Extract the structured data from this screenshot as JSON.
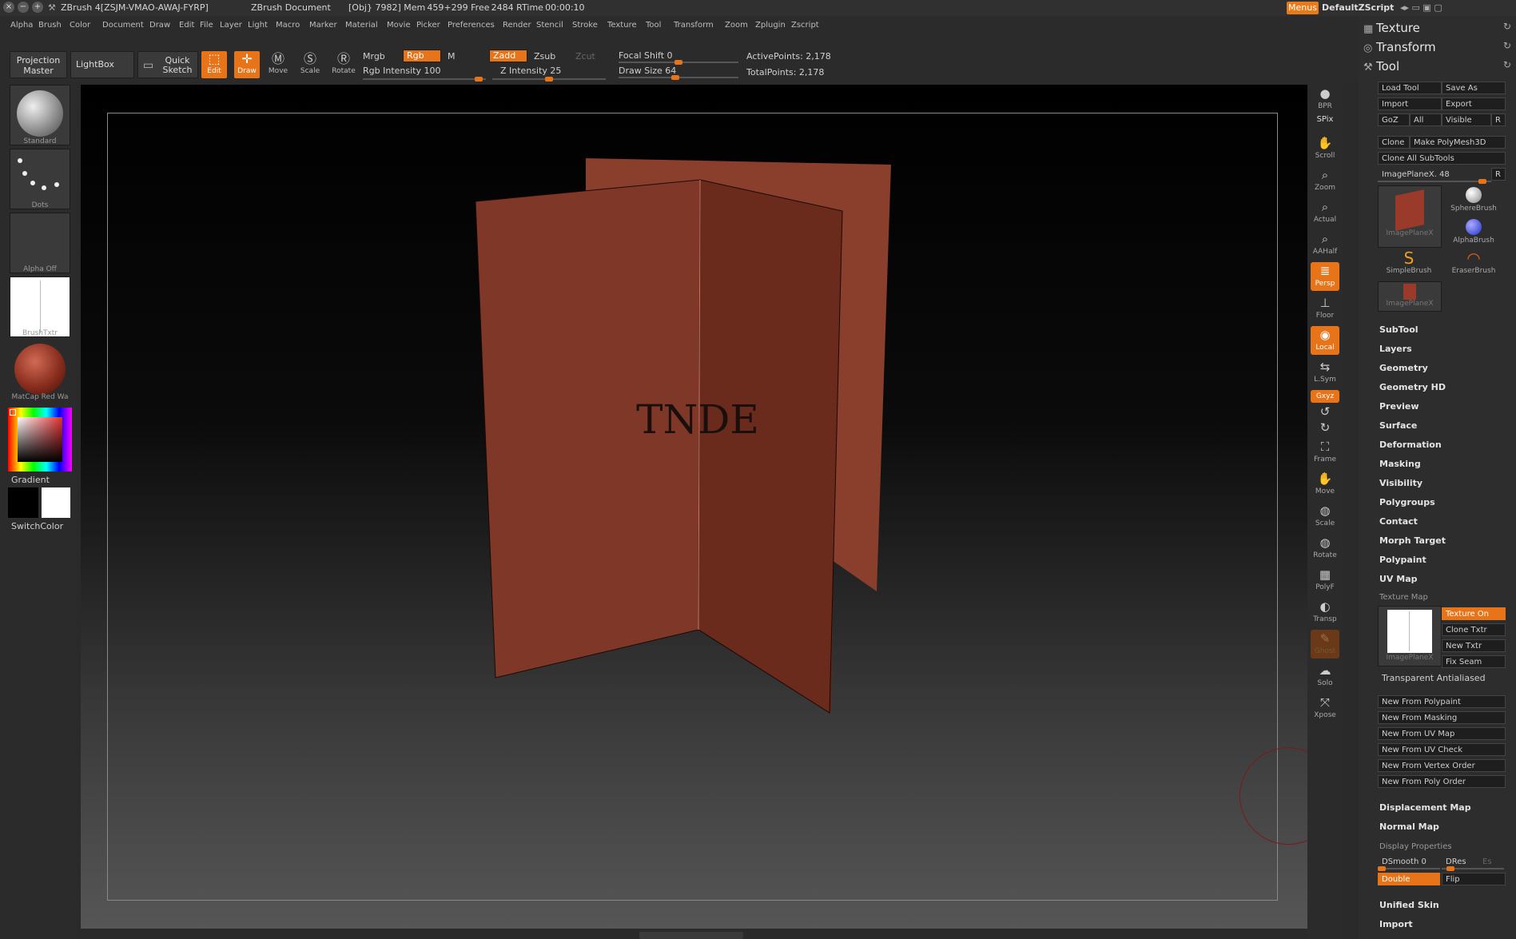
{
  "titlebar": {
    "app_title": "ZBrush 4[ZSJM-VMAO-AWAJ-FYRP]",
    "document": "ZBrush Document",
    "status": "[Obj} 7982] Mem 459+299 Free 2484 RTime 00:00:10",
    "menus_label": "Menus",
    "script_label": "DefaultZScript"
  },
  "menubar": [
    "Alpha",
    "Brush",
    "Color",
    "Document",
    "Draw",
    "Edit",
    "File",
    "Layer",
    "Light",
    "Macro",
    "Marker",
    "Material",
    "Movie",
    "Picker",
    "Preferences",
    "Render",
    "Stencil",
    "Stroke",
    "Texture",
    "Tool",
    "Transform",
    "Zoom",
    "Zplugin",
    "Zscript"
  ],
  "toolbar": {
    "projection_master": "Projection Master",
    "lightbox": "LightBox",
    "quick_sketch": "Quick Sketch",
    "edit": "Edit",
    "draw": "Draw",
    "move": "Move",
    "scale": "Scale",
    "rotate": "Rotate",
    "mrgb": "Mrgb",
    "rgb": "Rgb",
    "m": "M",
    "rgb_intensity_label": "Rgb  Intensity 100",
    "rgb_intensity": 100,
    "zadd": "Zadd",
    "zsub": "Zsub",
    "zcut": "Zcut",
    "z_intensity_label": "Z  Intensity 25",
    "z_intensity": 25,
    "focal_shift_label": "Focal  Shift 0",
    "focal_shift": 0,
    "draw_size_label": "Draw  Size 64",
    "draw_size": 64,
    "active_points": "ActivePoints: 2,178",
    "total_points": "TotalPoints: 2,178"
  },
  "leftshelf": {
    "brush": "Standard",
    "stroke": "Dots",
    "alpha": "Alpha  Off",
    "texture": "BrushTxtr",
    "material": "MatCap  Red  Wa",
    "gradient": "Gradient",
    "switch_color": "SwitchColor"
  },
  "viewport": {
    "model_text": "TNDE"
  },
  "rightshelf": [
    "BPR",
    "SPix",
    "Scroll",
    "Zoom",
    "Actual",
    "AAHalf",
    "Persp",
    "Floor",
    "Local",
    "L.Sym",
    "Gxyz",
    "",
    "",
    "Frame",
    "Move",
    "Scale",
    "Rotate",
    "PolyF",
    "Transp",
    "Ghost",
    "Solo",
    "Xpose"
  ],
  "palette": {
    "heads": [
      "Texture",
      "Transform",
      "Tool"
    ],
    "tool_buttons": {
      "load_tool": "Load  Tool",
      "save_as": "Save  As",
      "import": "Import",
      "export": "Export",
      "goz": "GoZ",
      "all": "All",
      "visible": "Visible",
      "r": "R",
      "clone": "Clone",
      "make_polymesh": "Make  PolyMesh3D",
      "clone_all": "Clone  All  SubTools",
      "imageplane": "ImagePlaneX. 48",
      "r2": "R"
    },
    "tool_thumbs": [
      "ImagePlaneX",
      "SphereBrush",
      "AlphaBrush",
      "SimpleBrush",
      "EraserBrush",
      "ImagePlaneX"
    ],
    "sub_palettes": [
      "SubTool",
      "Layers",
      "Geometry",
      "Geometry HD",
      "Preview",
      "Surface",
      "Deformation",
      "Masking",
      "Visibility",
      "Polygroups",
      "Contact",
      "Morph Target",
      "Polypaint",
      "UV Map"
    ],
    "texture_map": {
      "title": "Texture Map",
      "thumb": "ImagePlaneX",
      "texture_on": "Texture  On",
      "clone_txtr": "Clone  Txtr",
      "new_txtr": "New  Txtr",
      "fix_seam": "Fix  Seam",
      "transparent": "Transparent  Antialiased",
      "new_buttons": [
        "New  From  Polypaint",
        "New  From  Masking",
        "New  From  UV  Map",
        "New  From  UV  Check",
        "New  From  Vertex  Order",
        "New  From  Poly  Order"
      ]
    },
    "displacement_map": "Displacement Map",
    "normal_map": "Normal Map",
    "display_properties": {
      "title": "Display Properties",
      "dsmooth": "DSmooth 0",
      "dres": "DRes",
      "es": "Es",
      "double": "Double",
      "flip": "Flip"
    },
    "unified_skin": "Unified Skin",
    "import_bottom": "Import"
  },
  "colors": {
    "accent": "#e8741a",
    "plane": "#7a3a2a"
  }
}
